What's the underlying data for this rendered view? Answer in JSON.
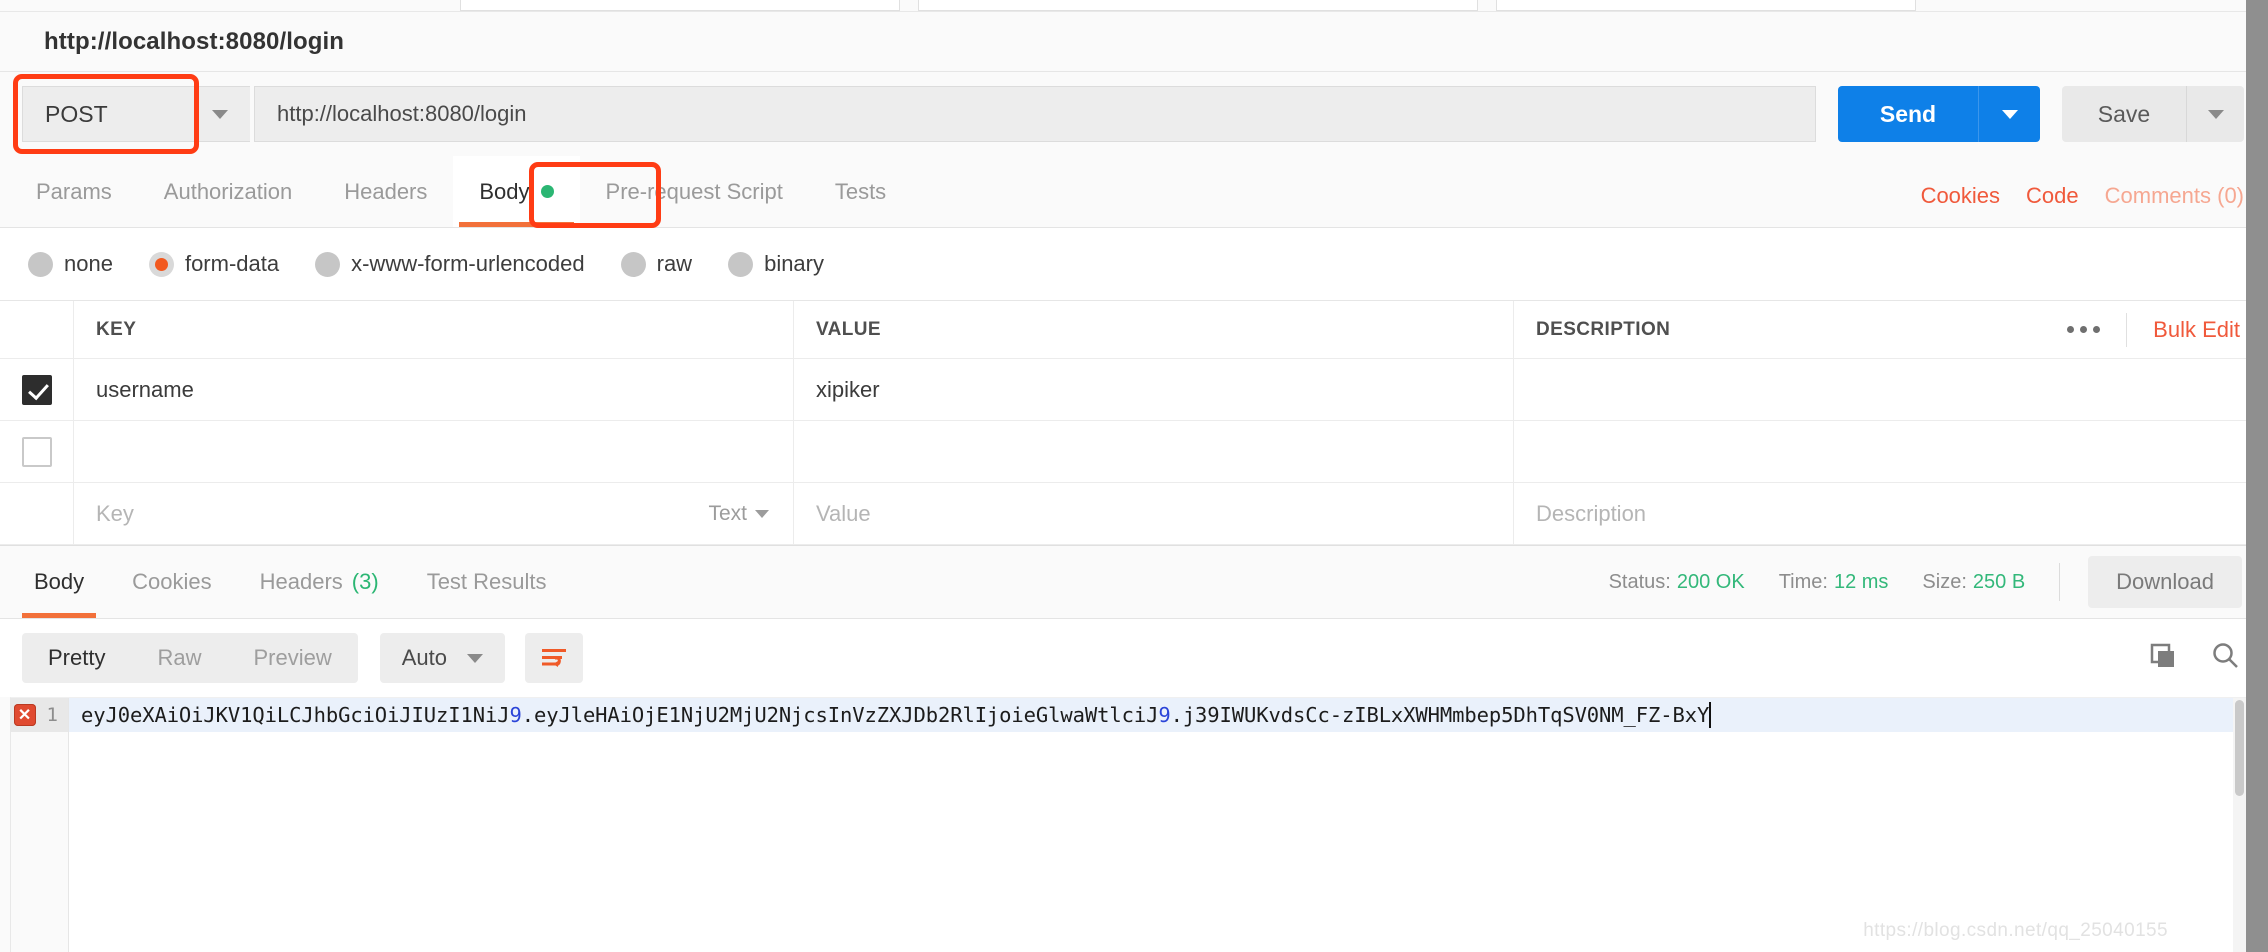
{
  "request": {
    "title": "http://localhost:8080/login",
    "method": "POST",
    "url": "http://localhost:8080/login",
    "send_label": "Send",
    "save_label": "Save"
  },
  "request_tabs": {
    "items": [
      {
        "label": "Params",
        "active": false
      },
      {
        "label": "Authorization",
        "active": false
      },
      {
        "label": "Headers",
        "active": false
      },
      {
        "label": "Body",
        "active": true
      },
      {
        "label": "Pre-request Script",
        "active": false
      },
      {
        "label": "Tests",
        "active": false
      }
    ],
    "right_links": [
      {
        "label": "Cookies"
      },
      {
        "label": "Code"
      },
      {
        "label": "Comments (0)"
      }
    ]
  },
  "body_types": {
    "options": [
      {
        "label": "none",
        "selected": false
      },
      {
        "label": "form-data",
        "selected": true
      },
      {
        "label": "x-www-form-urlencoded",
        "selected": false
      },
      {
        "label": "raw",
        "selected": false
      },
      {
        "label": "binary",
        "selected": false
      }
    ]
  },
  "form_table": {
    "headers": {
      "key": "KEY",
      "value": "VALUE",
      "description": "DESCRIPTION"
    },
    "bulk_edit_label": "Bulk Edit",
    "rows": [
      {
        "checked": true,
        "key": "username",
        "value": "xipiker",
        "description": ""
      },
      {
        "checked": false,
        "key": "",
        "value": "",
        "description": ""
      }
    ],
    "placeholder_row": {
      "key": "Key",
      "type": "Text",
      "value": "Value",
      "description": "Description"
    }
  },
  "response_tabs": {
    "items": [
      {
        "label": "Body",
        "active": true,
        "count": ""
      },
      {
        "label": "Cookies",
        "active": false,
        "count": ""
      },
      {
        "label": "Headers",
        "active": false,
        "count": "(3)"
      },
      {
        "label": "Test Results",
        "active": false,
        "count": ""
      }
    ],
    "meta": {
      "status_label": "Status:",
      "status_value": "200 OK",
      "time_label": "Time:",
      "time_value": "12 ms",
      "size_label": "Size:",
      "size_value": "250 B"
    },
    "download_label": "Download"
  },
  "viewer_toolbar": {
    "modes": [
      {
        "label": "Pretty",
        "active": true
      },
      {
        "label": "Raw",
        "active": false
      },
      {
        "label": "Preview",
        "active": false
      }
    ],
    "format_label": "Auto"
  },
  "response_body": {
    "line_number": "1",
    "token_part1": "eyJ0eXAiOiJKV1QiLCJhbGciOiJIUzI1NiJ",
    "token_sep1": "9",
    "token_part2": ".eyJleHAiOjE1NjU2MjU2NjcsInVzZXJDb2RlIjoieGlwaWtlciJ",
    "token_sep2": "9",
    "token_part3": ".j39IWUKvdsCc-zIBLxXWHMmbep5DhTqSV0NM_FZ-BxY",
    "watermark": "https://blog.csdn.net/qq_25040155"
  },
  "colors": {
    "accent_orange": "#f2703a",
    "highlight_red": "#ff3c14",
    "send_blue": "#0e80e8",
    "status_green": "#33b87a"
  }
}
